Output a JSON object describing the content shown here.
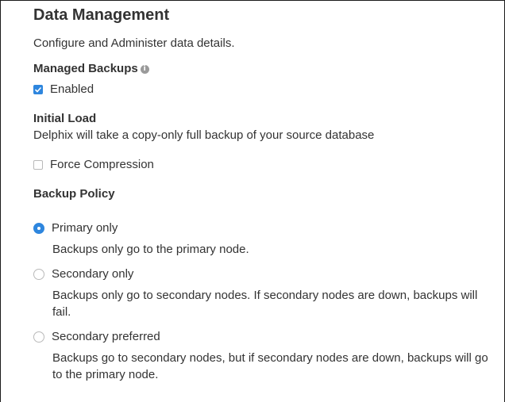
{
  "section": {
    "title": "Data Management",
    "subtitle": "Configure and Administer data details."
  },
  "managed_backups": {
    "label": "Managed Backups",
    "info_icon": "info-icon",
    "checkbox_label": "Enabled",
    "checked": true
  },
  "initial_load": {
    "label": "Initial Load",
    "description": "Delphix will take a copy-only full backup of your source database"
  },
  "force_compression": {
    "checkbox_label": "Force Compression",
    "checked": false
  },
  "backup_policy": {
    "label": "Backup Policy",
    "options": [
      {
        "label": "Primary only",
        "description": "Backups only go to the primary node.",
        "selected": true
      },
      {
        "label": "Secondary only",
        "description": "Backups only go to secondary nodes. If secondary nodes are down, backups will fail.",
        "selected": false
      },
      {
        "label": "Secondary preferred",
        "description": "Backups go to secondary nodes, but if secondary nodes are down, backups will go to the primary node.",
        "selected": false
      }
    ]
  },
  "colors": {
    "accent": "#2e86de",
    "text": "#333333",
    "muted_border": "#b9b9b9"
  }
}
